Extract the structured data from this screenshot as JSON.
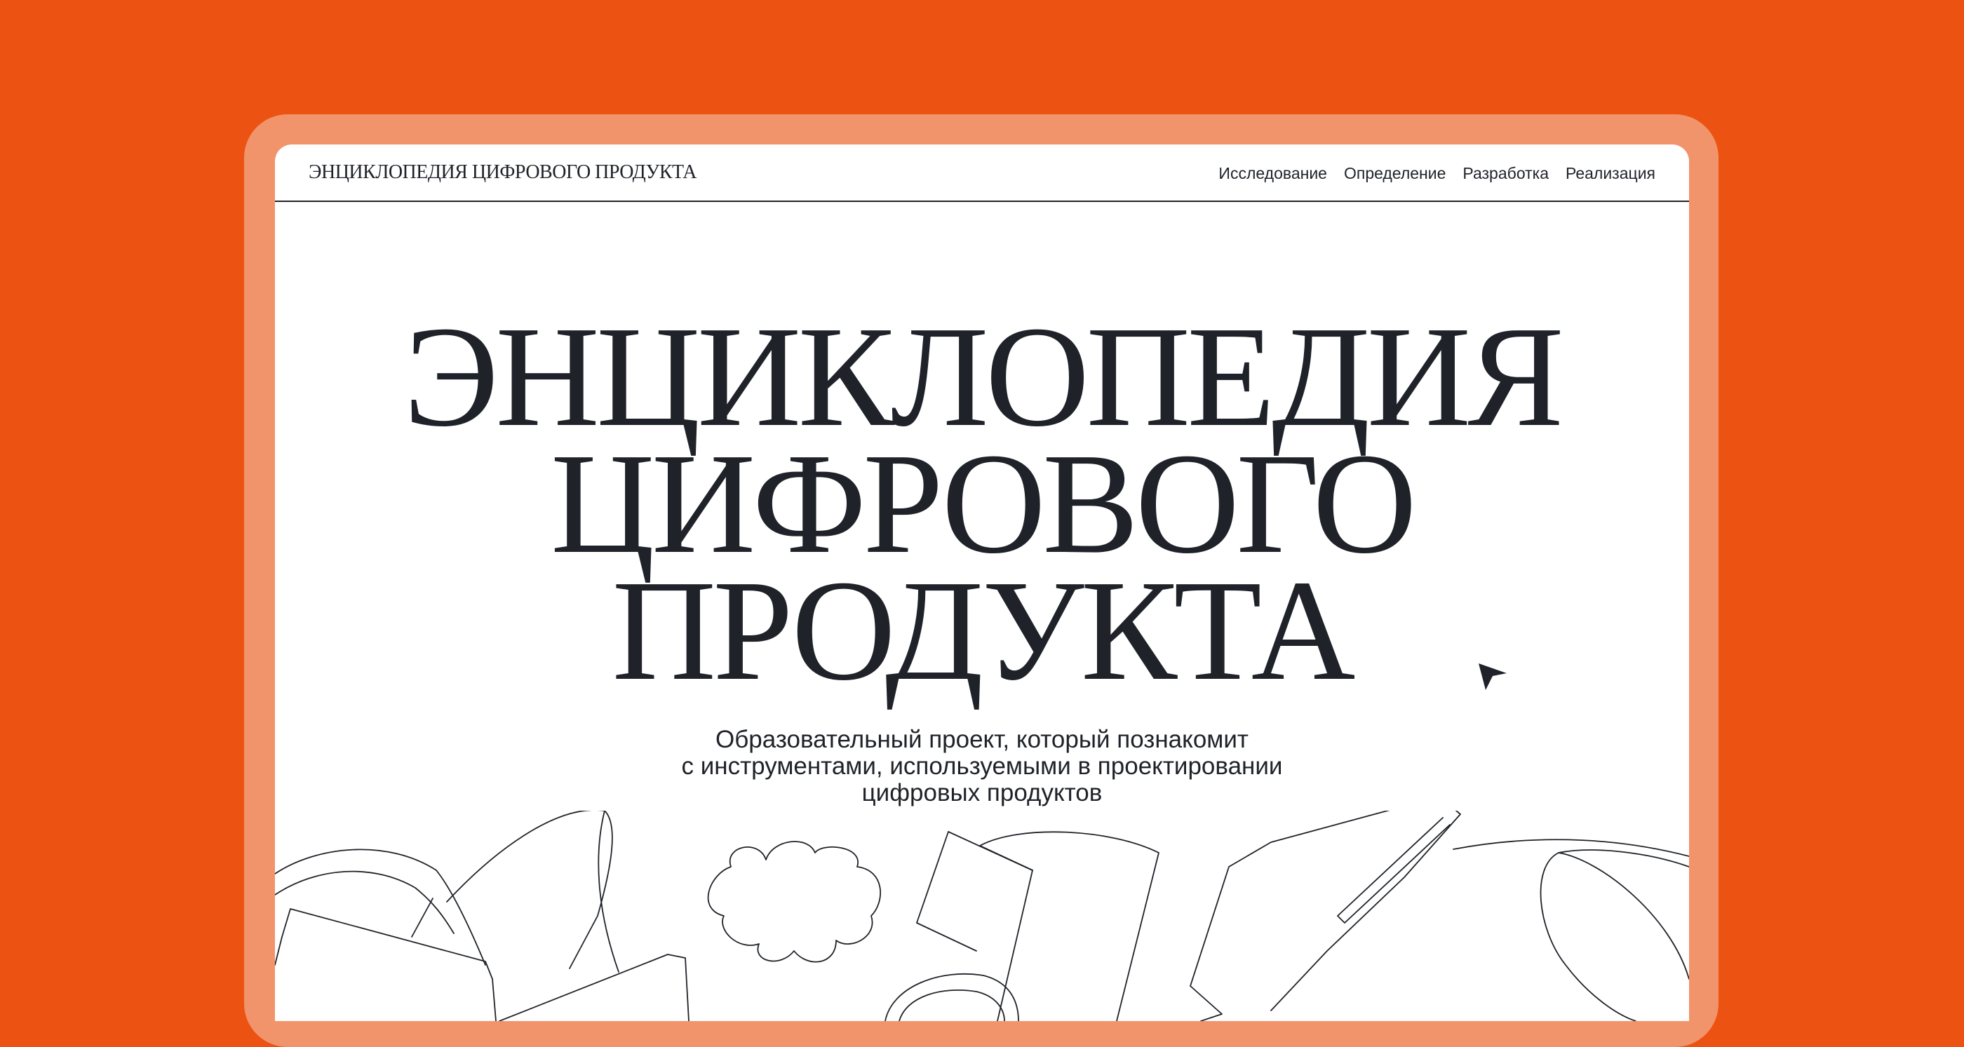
{
  "header": {
    "brand": "ЭНЦИКЛОПЕДИЯ ЦИФРОВОГО ПРОДУКТА",
    "nav": [
      {
        "label": "Исследование"
      },
      {
        "label": "Определение"
      },
      {
        "label": "Разработка"
      },
      {
        "label": "Реализация"
      }
    ]
  },
  "hero": {
    "title_lines": [
      "ЭНЦИКЛОПЕДИЯ",
      "ЦИФРОВОГО",
      "ПРОДУКТА"
    ],
    "subtitle_lines": [
      "Образовательный проект, который познакомит",
      "с инструментами, используемыми в проектировании",
      "цифровых продуктов"
    ]
  },
  "icons": {
    "cursor": "mouse-pointer-icon"
  },
  "colors": {
    "background": "#EC5312",
    "frame": "#F2946B",
    "screen": "#FFFFFF",
    "ink": "#1f2329"
  }
}
